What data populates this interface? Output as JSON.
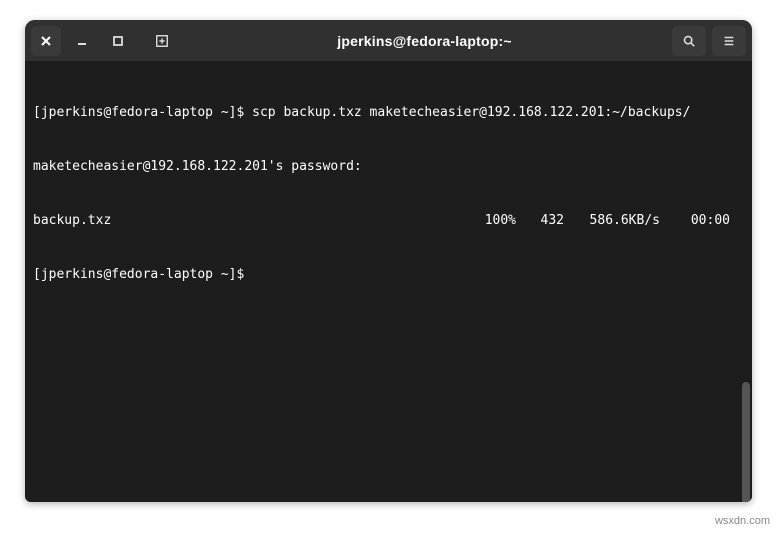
{
  "titlebar": {
    "title": "jperkins@fedora-laptop:~"
  },
  "terminal": {
    "prompt1": "[jperkins@fedora-laptop ~]$ ",
    "command1": "scp backup.txz maketecheasier@192.168.122.201:~/backups/",
    "password_line": "maketecheasier@192.168.122.201's password:",
    "transfer": {
      "file": "backup.txz",
      "percent": "100%",
      "size": "432",
      "rate": "586.6KB/s",
      "time": "00:00"
    },
    "prompt2": "[jperkins@fedora-laptop ~]$ "
  },
  "watermark": "wsxdn.com"
}
